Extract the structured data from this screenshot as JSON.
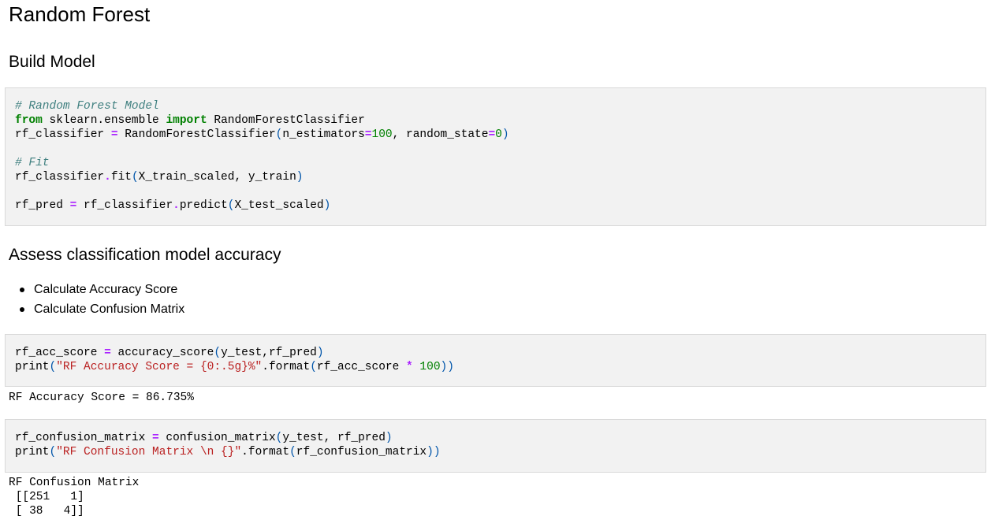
{
  "headings": {
    "title": "Random Forest",
    "build_model": "Build Model",
    "assess": "Assess classification model accuracy"
  },
  "bullets": [
    "Calculate Accuracy Score",
    "Calculate Confusion Matrix"
  ],
  "cells": {
    "build": {
      "comment_model": "# Random Forest Model",
      "kw_from": "from",
      "module": " sklearn.ensemble ",
      "kw_import": "import",
      "import_name": " RandomForestClassifier",
      "assign_lhs": "rf_classifier ",
      "op_eq": "=",
      "ctor": " RandomForestClassifier",
      "paren_open": "(",
      "arg1_name": "n_estimators",
      "arg1_eq": "=",
      "arg1_val": "100",
      "comma": ", ",
      "arg2_name": "random_state",
      "arg2_eq": "=",
      "arg2_val": "0",
      "paren_close": ")",
      "comment_fit": "# Fit",
      "fit_obj": "rf_classifier",
      "fit_dot": ".",
      "fit_method": "fit",
      "fit_open": "(",
      "fit_args": "X_train_scaled, y_train",
      "fit_close": ")",
      "pred_lhs": "rf_pred ",
      "pred_eq": "=",
      "pred_obj": " rf_classifier",
      "pred_dot": ".",
      "pred_method": "predict",
      "pred_open": "(",
      "pred_args": "X_test_scaled",
      "pred_close": ")"
    },
    "accuracy": {
      "lhs": "rf_acc_score ",
      "eq": "=",
      "call": " accuracy_score",
      "open": "(",
      "args": "y_test,rf_pred",
      "close": ")",
      "print": "print",
      "p_open": "(",
      "str": "\"RF Accuracy Score = {0:.5g}%\"",
      "format": ".format",
      "f_open": "(",
      "f_arg": "rf_acc_score ",
      "mul": "*",
      "sp": " ",
      "hundred": "100",
      "f_close": "))",
      "output": "RF Accuracy Score = 86.735%"
    },
    "confusion": {
      "lhs": "rf_confusion_matrix ",
      "eq": "=",
      "call": " confusion_matrix",
      "open": "(",
      "args": "y_test, rf_pred",
      "close": ")",
      "print": "print",
      "p_open": "(",
      "str": "\"RF Confusion Matrix \\n {}\"",
      "format": ".format",
      "f_open": "(",
      "f_arg": "rf_confusion_matrix",
      "f_close": "))",
      "output": "RF Confusion Matrix\n [[251   1]\n [ 38   4]]"
    }
  }
}
